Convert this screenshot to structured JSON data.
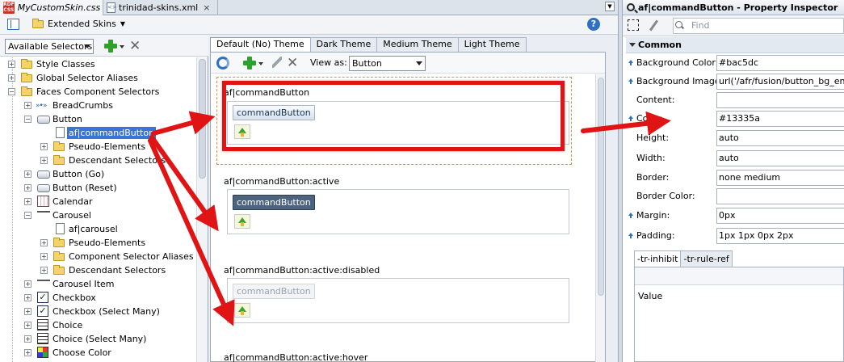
{
  "editor_tabs": [
    {
      "label": "MyCustomSkin.css"
    },
    {
      "label": "trinidad-skins.xml"
    }
  ],
  "editor_toolbar": {
    "skins_label": "Extended Skins"
  },
  "left_panel": {
    "selector_combo": "Available Selectors",
    "tree": [
      {
        "label": "Style Classes"
      },
      {
        "label": "Global Selector Aliases"
      },
      {
        "label": "Faces Component Selectors"
      },
      {
        "label": "BreadCrumbs"
      },
      {
        "label": "Button"
      },
      {
        "label": "af|commandButton"
      },
      {
        "label": "Pseudo-Elements"
      },
      {
        "label": "Descendant Selectors"
      },
      {
        "label": "Button (Go)"
      },
      {
        "label": "Button (Reset)"
      },
      {
        "label": "Calendar"
      },
      {
        "label": "Carousel"
      },
      {
        "label": "af|carousel"
      },
      {
        "label": "Pseudo-Elements"
      },
      {
        "label": "Component Selector Aliases"
      },
      {
        "label": "Descendant Selectors"
      },
      {
        "label": "Carousel Item"
      },
      {
        "label": "Checkbox"
      },
      {
        "label": "Checkbox (Select Many)"
      },
      {
        "label": "Choice"
      },
      {
        "label": "Choice (Select Many)"
      },
      {
        "label": "Choose Color"
      }
    ]
  },
  "theme_tabs": [
    {
      "label": "Default (No) Theme"
    },
    {
      "label": "Dark Theme"
    },
    {
      "label": "Medium Theme"
    },
    {
      "label": "Light Theme"
    }
  ],
  "preview_toolbar": {
    "view_as_label": "View as:",
    "view_as_value": "Button"
  },
  "preview": [
    {
      "title": "af|commandButton",
      "button": "commandButton"
    },
    {
      "title": "af|commandButton:active",
      "button": "commandButton"
    },
    {
      "title": "af|commandButton:active:disabled",
      "button": "commandButton"
    },
    {
      "title": "af|commandButton:active:hover"
    }
  ],
  "inspector": {
    "title": "af|commandButton - Property Inspector",
    "find_placeholder": "Find",
    "section": "Common",
    "properties": [
      {
        "label": "Background Color:",
        "value": "#bac5dc"
      },
      {
        "label": "Background Image:",
        "value": "url('/afr/fusion/button_bg_ena.png"
      },
      {
        "label": "Content:",
        "value": ""
      },
      {
        "label": "Color:",
        "value": "#13335a"
      },
      {
        "label": "Height:",
        "value": "auto"
      },
      {
        "label": "Width:",
        "value": "auto"
      },
      {
        "label": "Border:",
        "value": "none medium"
      },
      {
        "label": "Border Color:",
        "value": ""
      },
      {
        "label": "Margin:",
        "value": "0px"
      },
      {
        "label": "Padding:",
        "value": "1px 1px 0px 2px"
      }
    ],
    "sub_tabs": [
      {
        "label": "-tr-inhibit"
      },
      {
        "label": "-tr-rule-ref"
      }
    ],
    "table_value_label": "Value"
  },
  "colors": {
    "annotation": "#e01414",
    "selection": "#3875d7",
    "focus_outline": "#ee8a3a"
  }
}
